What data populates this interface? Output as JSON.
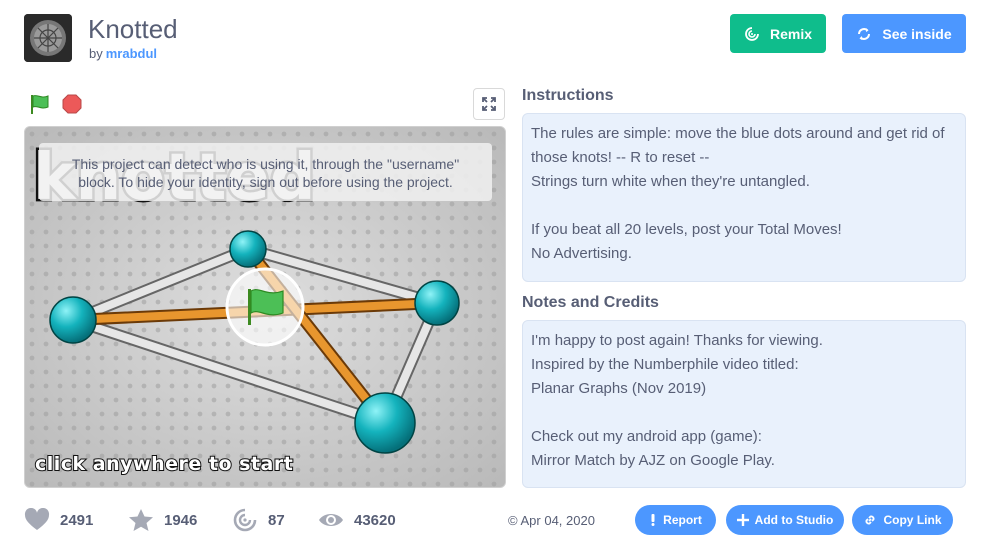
{
  "project": {
    "title": "Knotted",
    "by_label": "by",
    "author": "mrabdul"
  },
  "buttons": {
    "remix": "Remix",
    "see_inside": "See inside"
  },
  "stage": {
    "notice": "This project can detect who is using it, through the \"username\" block. To hide your identity, sign out before using the project.",
    "start_text": "click anywhere to start"
  },
  "instructions": {
    "heading": "Instructions",
    "text": "The rules are simple: move the blue dots around and get rid of those knots! -- R to reset --\nStrings turn white when they're untangled.\n\nIf you beat all 20 levels, post your Total Moves!\nNo Advertising."
  },
  "notes": {
    "heading": "Notes and Credits",
    "text": "I'm happy to post again! Thanks for viewing.\nInspired by the Numberphile video titled:\nPlanar Graphs (Nov 2019)\n\nCheck out my android app (game):\nMirror Match by AJZ on Google Play."
  },
  "stats": {
    "loves": "2491",
    "favorites": "1946",
    "remixes": "87",
    "views": "43620"
  },
  "date": "Apr 04, 2020",
  "actions": {
    "report": "Report",
    "add_to_studio": "Add to Studio",
    "copy_link": "Copy Link"
  },
  "icons": {
    "remix": "remix-icon",
    "see_inside": "see-inside-icon",
    "green_flag": "green-flag-icon",
    "stop": "stop-icon",
    "fullscreen": "fullscreen-icon",
    "love": "heart-icon",
    "favorite": "star-icon",
    "remixes": "remix-spiral-icon",
    "views": "eye-icon",
    "report": "report-icon",
    "add": "plus-icon",
    "link": "link-icon"
  },
  "colors": {
    "remix_button": "#0fbd8c",
    "primary_blue": "#4c97ff",
    "panel_bg": "#e9f1fc",
    "text": "#575e75"
  }
}
